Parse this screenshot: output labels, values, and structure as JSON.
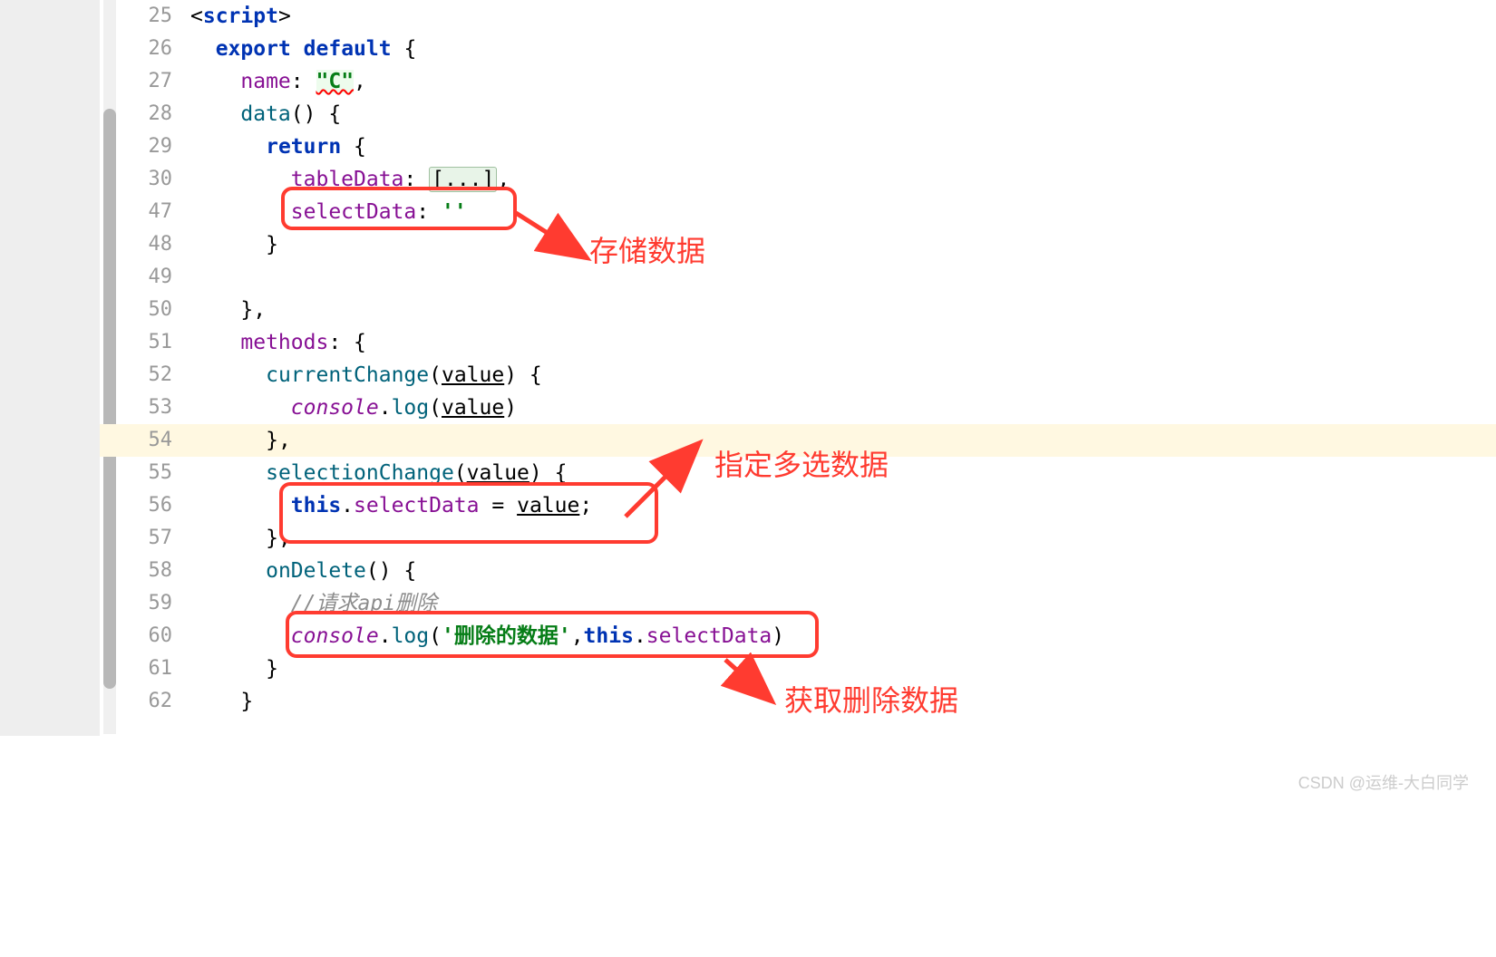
{
  "lines": [
    {
      "num": "25",
      "indent": 0
    },
    {
      "num": "26",
      "indent": 1
    },
    {
      "num": "27",
      "indent": 2
    },
    {
      "num": "28",
      "indent": 2
    },
    {
      "num": "29",
      "indent": 3
    },
    {
      "num": "30",
      "indent": 4
    },
    {
      "num": "47",
      "indent": 4
    },
    {
      "num": "48",
      "indent": 3
    },
    {
      "num": "49",
      "indent": 0
    },
    {
      "num": "50",
      "indent": 2
    },
    {
      "num": "51",
      "indent": 2
    },
    {
      "num": "52",
      "indent": 3
    },
    {
      "num": "53",
      "indent": 4
    },
    {
      "num": "54",
      "indent": 3,
      "highlight": true
    },
    {
      "num": "55",
      "indent": 3
    },
    {
      "num": "56",
      "indent": 4
    },
    {
      "num": "57",
      "indent": 3
    },
    {
      "num": "58",
      "indent": 3
    },
    {
      "num": "59",
      "indent": 4
    },
    {
      "num": "60",
      "indent": 4
    },
    {
      "num": "61",
      "indent": 3
    },
    {
      "num": "62",
      "indent": 2
    }
  ],
  "code": {
    "l25_script": "script",
    "l26_export": "export",
    "l26_default": "default",
    "l27_name": "name",
    "l27_val": "\"C\"",
    "l28_data": "data",
    "l29_return": "return",
    "l30_tableData": "tableData",
    "l30_bracket": "[...]",
    "l47_selectData": "selectData",
    "l47_val": "''",
    "l51_methods": "methods",
    "l52_currentChange": "currentChange",
    "l52_value": "value",
    "l53_console": "console",
    "l53_log": "log",
    "l53_value": "value",
    "l55_selectionChange": "selectionChange",
    "l55_value": "value",
    "l56_this": "this",
    "l56_selectData": "selectData",
    "l56_value": "value",
    "l58_onDelete": "onDelete",
    "l59_comment": "//请求api删除",
    "l60_console": "console",
    "l60_log": "log",
    "l60_str": "'删除的数据'",
    "l60_this": "this",
    "l60_selectData": "selectData"
  },
  "annotations": {
    "a1_text": "存储数据",
    "a2_text": "指定多选数据",
    "a3_text": "获取删除数据"
  },
  "watermark": "CSDN @运维-大白同学",
  "colors": {
    "annotation": "#ff3b30",
    "keyword": "#0033b3",
    "string": "#067d17",
    "property": "#871094",
    "comment": "#8c8c8c"
  }
}
